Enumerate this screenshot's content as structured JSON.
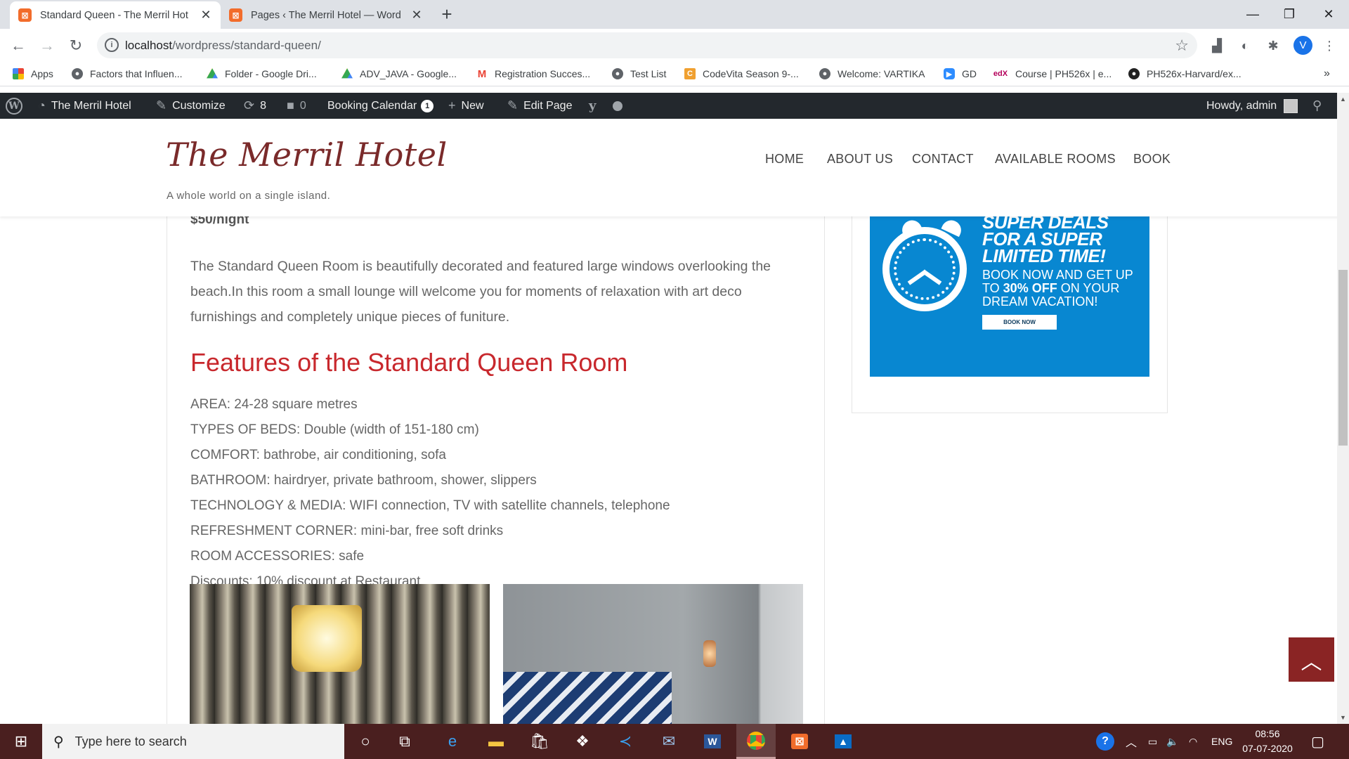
{
  "browser": {
    "tabs": [
      {
        "title": "Standard Queen - The Merril Hot",
        "active": true
      },
      {
        "title": "Pages ‹ The Merril Hotel — Word",
        "active": false
      }
    ],
    "url_host": "localhost",
    "url_path": "/wordpress/standard-queen/",
    "profile_initial": "V",
    "bookmarks": [
      {
        "label": "Apps",
        "icon": "apps-grid-icon"
      },
      {
        "label": "Factors that Influen...",
        "icon": "globe-icon"
      },
      {
        "label": "Folder - Google Dri...",
        "icon": "google-drive-icon"
      },
      {
        "label": "ADV_JAVA - Google...",
        "icon": "google-drive-icon"
      },
      {
        "label": "Registration Succes...",
        "icon": "gmail-icon"
      },
      {
        "label": "Test List",
        "icon": "globe-icon"
      },
      {
        "label": "CodeVita Season 9-...",
        "icon": "codevita-icon"
      },
      {
        "label": "Welcome: VARTIKA",
        "icon": "globe-icon"
      },
      {
        "label": "GD",
        "icon": "zoom-icon"
      },
      {
        "label": "Course | PH526x | e...",
        "icon": "edx-icon"
      },
      {
        "label": "PH526x-Harvard/ex...",
        "icon": "github-icon"
      }
    ]
  },
  "adminbar": {
    "site_name": "The Merril Hotel",
    "customize": "Customize",
    "updates_count": "8",
    "comments_count": "0",
    "booking_calendar": "Booking Calendar",
    "booking_badge": "1",
    "new": "New",
    "edit_page": "Edit Page",
    "howdy": "Howdy, admin"
  },
  "site": {
    "title": "The Merril Hotel",
    "tagline": "A whole world on a single island.",
    "nav": [
      "HOME",
      "ABOUT US",
      "CONTACT",
      "AVAILABLE ROOMS",
      "BOOK"
    ]
  },
  "room": {
    "price": "$50/night",
    "description": "The Standard Queen Room is beautifully decorated and featured large windows overlooking the beach.In this room a small lounge will welcome you for moments of relaxation with art deco furnishings and completely unique pieces of funiture.",
    "features_title": "Features of the Standard Queen Room",
    "features": [
      "AREA: 24-28 square metres",
      "TYPES OF BEDS: Double (width of 151-180 cm)",
      "COMFORT: bathrobe, air conditioning, sofa",
      "BATHROOM: hairdryer, private bathroom, shower, slippers",
      "TECHNOLOGY & MEDIA: WIFI connection, TV with satellite channels, telephone",
      "REFRESHMENT CORNER: mini-bar, free soft drinks",
      "ROOM ACCESSORIES: safe",
      "Discounts: 10% discount at Restaurant"
    ]
  },
  "promo": {
    "headline_1": "SUPER DEALS",
    "headline_2": "FOR A SUPER",
    "headline_3": "LIMITED TIME!",
    "body_1": "BOOK NOW AND GET UP",
    "body_2a": "TO ",
    "body_2b": "30% OFF",
    "body_2c": " ON YOUR",
    "body_3": "DREAM VACATION!",
    "button": "BOOK NOW",
    "color": "#0887d1"
  },
  "taskbar": {
    "search_placeholder": "Type here to search",
    "language": "ENG",
    "time": "08:56",
    "date": "07-07-2020"
  },
  "colors": {
    "heading_red": "#c8282d",
    "title_maroon": "#7a2a2a",
    "scrolltop_bg": "#8a2424",
    "adminbar_bg": "#23282d",
    "taskbar_bg": "#4a1f1f"
  }
}
